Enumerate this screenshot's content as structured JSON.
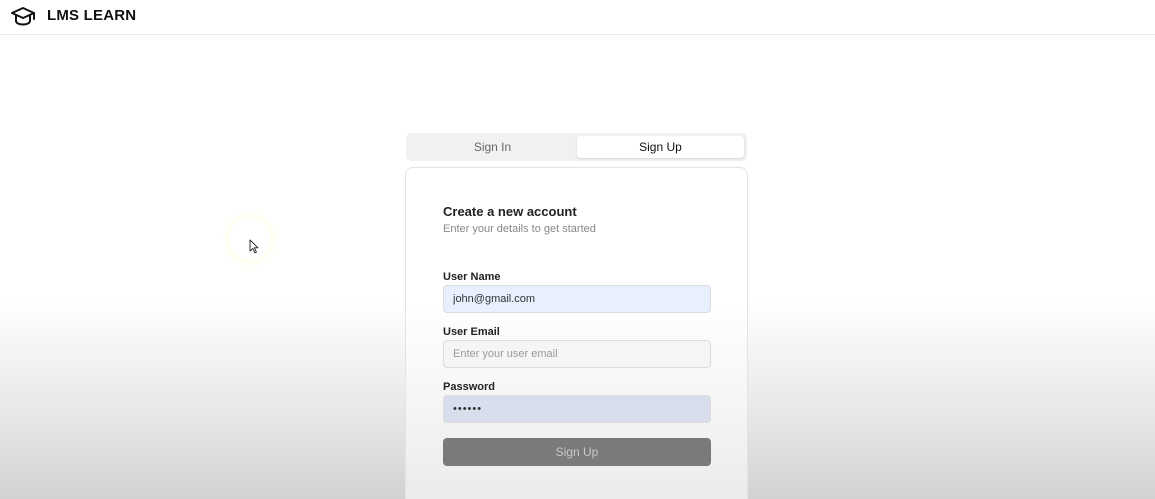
{
  "header": {
    "logo_icon": "graduation-cap-icon",
    "app_name": "LMS LEARN"
  },
  "tabs": [
    {
      "label": "Sign In",
      "active": false
    },
    {
      "label": "Sign Up",
      "active": true
    }
  ],
  "form": {
    "title": "Create a new account",
    "subtitle": "Enter your details to get started",
    "fields": {
      "username": {
        "label": "User Name",
        "value": "john@gmail.com",
        "placeholder": ""
      },
      "email": {
        "label": "User Email",
        "value": "",
        "placeholder": "Enter your user email"
      },
      "password": {
        "label": "Password",
        "value": "••••••"
      }
    },
    "submit_label": "Sign Up",
    "submit_color": "#7a7a7a"
  },
  "colors": {
    "autofill_background": "#e8f0fe",
    "password_background": "#d8deec"
  }
}
